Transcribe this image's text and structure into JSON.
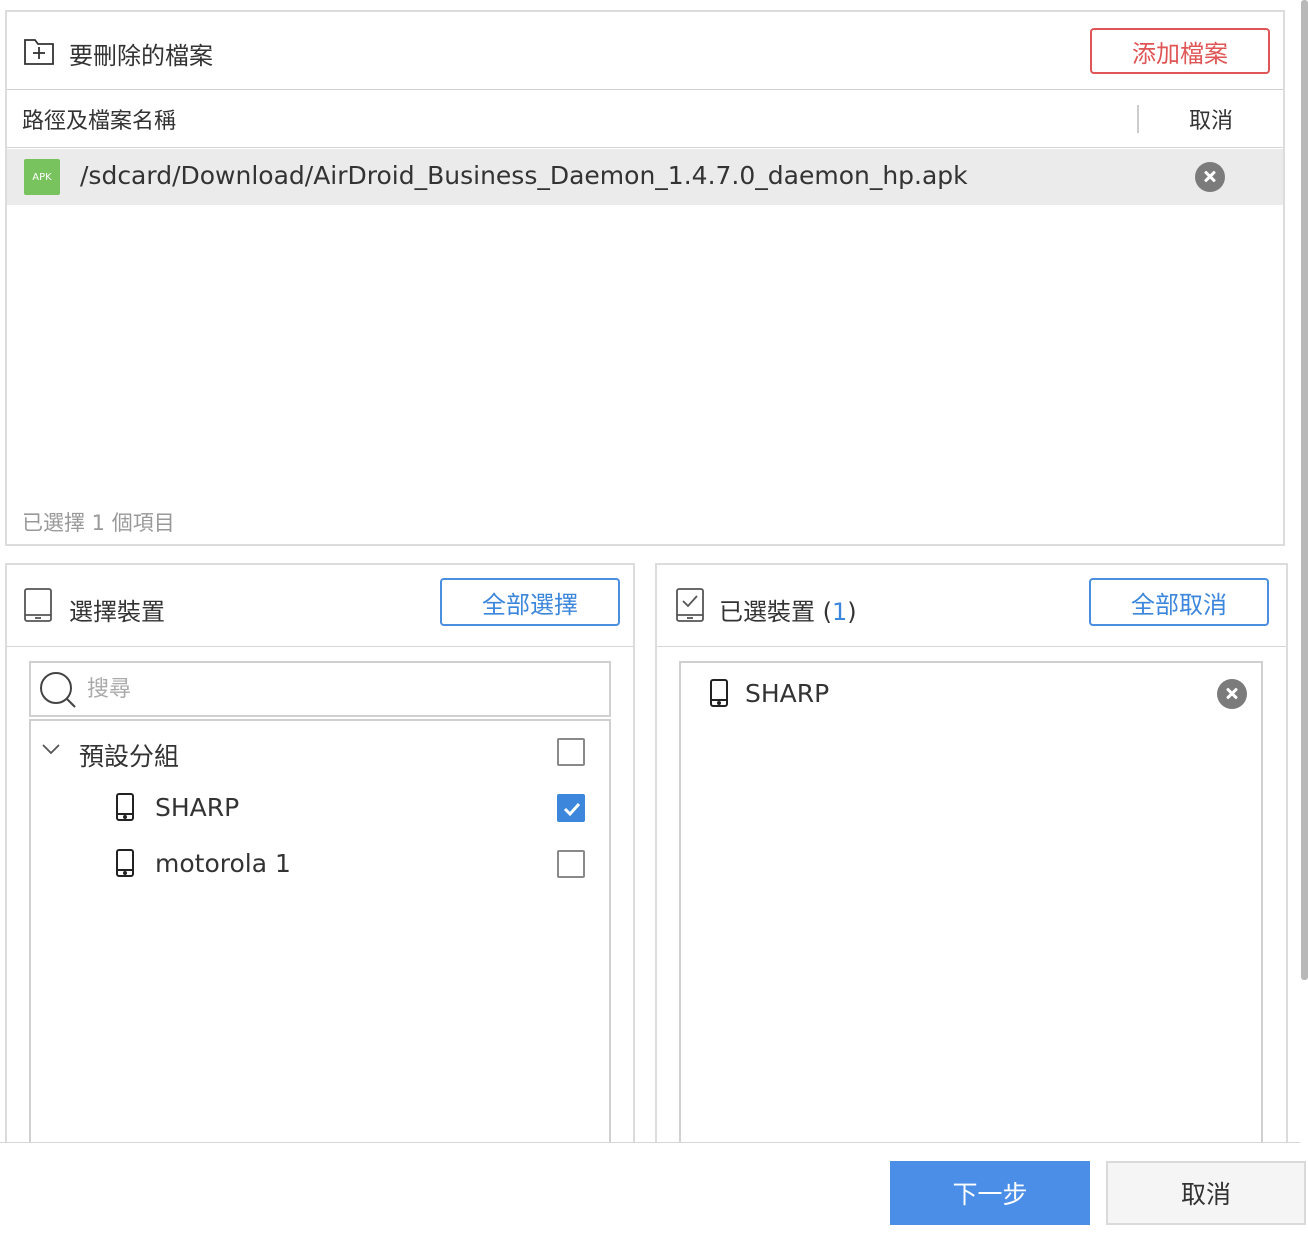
{
  "files_panel": {
    "title": "要刪除的檔案",
    "add_button": "添加檔案",
    "column_name": "路徑及檔案名稱",
    "column_cancel": "取消",
    "files": [
      {
        "type_badge": "APK",
        "path": "/sdcard/Download/AirDroid_Business_Daemon_1.4.7.0_daemon_hp.apk"
      }
    ],
    "selected_count_text": "已選擇 1 個項目"
  },
  "select_devices": {
    "title": "選擇裝置",
    "select_all_button": "全部選擇",
    "search_placeholder": "搜尋",
    "group": {
      "label": "預設分組",
      "checked": false,
      "devices": [
        {
          "name": "SHARP",
          "checked": true
        },
        {
          "name": "motorola 1",
          "checked": false
        }
      ]
    }
  },
  "selected_devices": {
    "title_prefix": "已選裝置 (",
    "count": "1",
    "title_suffix": ")",
    "deselect_all_button": "全部取消",
    "devices": [
      {
        "name": "SHARP"
      }
    ]
  },
  "footer": {
    "next_button": "下一步",
    "cancel_button": "取消"
  },
  "colors": {
    "accent_blue": "#3c86dc",
    "danger_red": "#e05555",
    "apk_green": "#79c35f"
  }
}
